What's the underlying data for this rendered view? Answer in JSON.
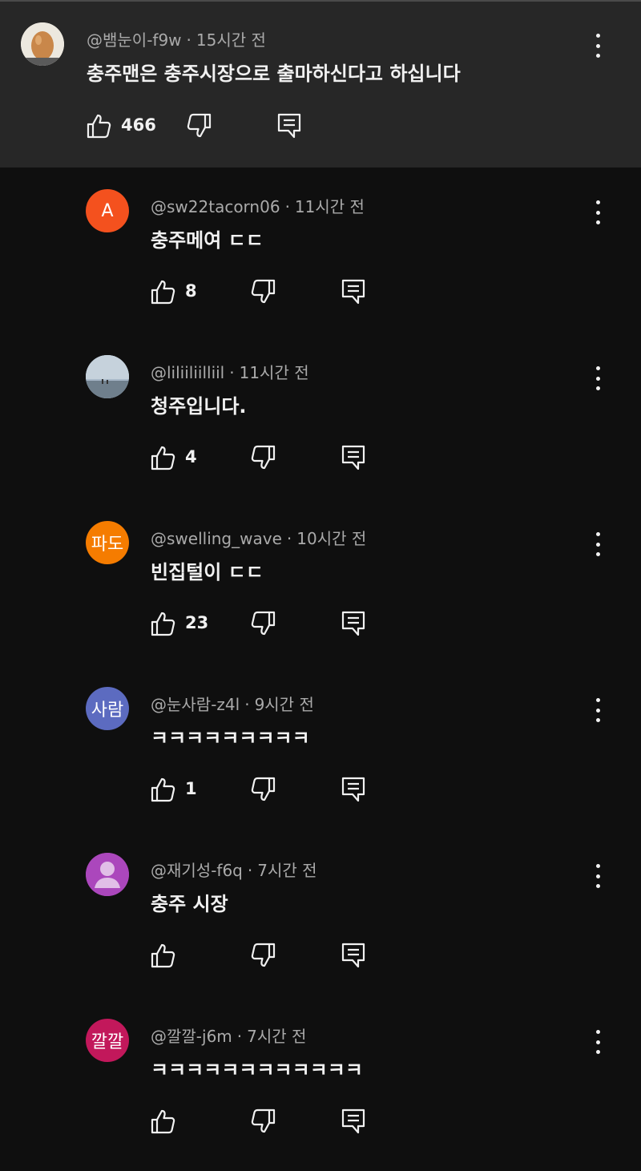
{
  "parent_comment": {
    "author": "@뱀눈이-f9w",
    "time": "15시간 전",
    "text": "충주맨은 충주시장으로 출마하신다고 하십니다",
    "likes": "466"
  },
  "separator": "·",
  "replies": [
    {
      "author": "@sw22tacorn06",
      "time": "11시간 전",
      "text": "충주메여 ㄷㄷ",
      "likes": "8",
      "avatar_label": "A",
      "avatar_color": "#f4511e"
    },
    {
      "author": "@liliiliilliil",
      "time": "11시간 전",
      "text": "청주입니다.",
      "likes": "4",
      "avatar_label": "",
      "avatar_color": "#8fa3b5"
    },
    {
      "author": "@swelling_wave",
      "time": "10시간 전",
      "text": "빈집털이 ㄷㄷ",
      "likes": "23",
      "avatar_label": "파도",
      "avatar_color": "#f57c00"
    },
    {
      "author": "@눈사람-z4l",
      "time": "9시간 전",
      "text": "ㅋㅋㅋㅋㅋㅋㅋㅋㅋ",
      "likes": "1",
      "avatar_label": "사람",
      "avatar_color": "#5c6bc0"
    },
    {
      "author": "@재기성-f6q",
      "time": "7시간 전",
      "text": "충주 시장",
      "likes": "",
      "avatar_label": "",
      "avatar_color": "#ab47bc"
    },
    {
      "author": "@깔깔-j6m",
      "time": "7시간 전",
      "text": "ㅋㅋㅋㅋㅋㅋㅋㅋㅋㅋㅋㅋ",
      "likes": "",
      "avatar_label": "깔깔",
      "avatar_color": "#c2185b"
    }
  ],
  "icons": {
    "like": "thumb-up-icon",
    "dislike": "thumb-down-icon",
    "reply": "reply-comment-icon",
    "more": "more-vert-icon"
  },
  "colors": {
    "background": "#0f0f0f",
    "highlight_background": "#272727",
    "primary_text": "#f1f1f1",
    "secondary_text": "#aaaaaa"
  }
}
